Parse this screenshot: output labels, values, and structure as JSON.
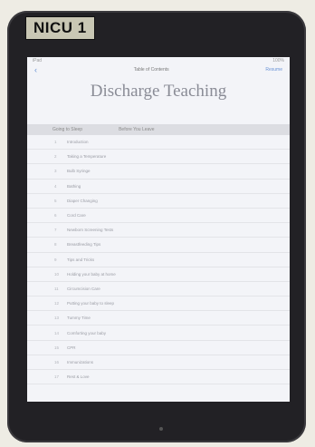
{
  "sticker": {
    "text": "NICU 1"
  },
  "status_bar": {
    "left": "iPad",
    "right": "100%"
  },
  "nav": {
    "back": "‹",
    "center": "Table of Contents",
    "right": "Resume"
  },
  "book": {
    "title": "Discharge Teaching"
  },
  "section_header": {
    "left": "Going to Sleep",
    "right": "Before You Leave"
  },
  "toc": [
    {
      "num": "1",
      "label": "Introduction"
    },
    {
      "num": "2",
      "label": "Taking a Temperature"
    },
    {
      "num": "3",
      "label": "Bulb Syringe"
    },
    {
      "num": "4",
      "label": "Bathing"
    },
    {
      "num": "5",
      "label": "Diaper Changing"
    },
    {
      "num": "6",
      "label": "Cord Care"
    },
    {
      "num": "7",
      "label": "Newborn Screening Tests"
    },
    {
      "num": "8",
      "label": "Breastfeeding Tips"
    },
    {
      "num": "9",
      "label": "Tips and Tricks"
    },
    {
      "num": "10",
      "label": "Holding your baby at home"
    },
    {
      "num": "11",
      "label": "Circumcision Care"
    },
    {
      "num": "12",
      "label": "Putting your baby to sleep"
    },
    {
      "num": "13",
      "label": "Tummy Time"
    },
    {
      "num": "14",
      "label": "Comforting your baby"
    },
    {
      "num": "15",
      "label": "CPR"
    },
    {
      "num": "16",
      "label": "Immunizations"
    },
    {
      "num": "17",
      "label": "Rest & Love"
    }
  ]
}
